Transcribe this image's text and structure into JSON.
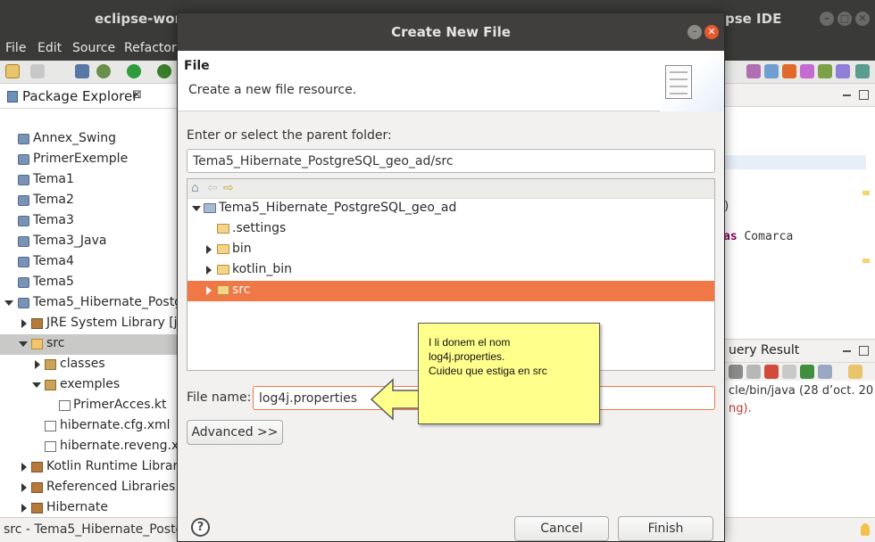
{
  "window": {
    "title_left": "eclipse-work",
    "title_right": "pse IDE",
    "controls": [
      "–",
      "□",
      "✕"
    ]
  },
  "menubar": [
    "File",
    "Edit",
    "Source",
    "Refactor"
  ],
  "explorer": {
    "tab_label": "Package Explorer",
    "tab_close": "⊠",
    "items": [
      {
        "label": "Annex_Swing",
        "icon": "project-icon"
      },
      {
        "label": "PrimerExemple",
        "icon": "project-icon"
      },
      {
        "label": "Tema1",
        "icon": "project-icon"
      },
      {
        "label": "Tema2",
        "icon": "project-icon"
      },
      {
        "label": "Tema3",
        "icon": "project-icon"
      },
      {
        "label": "Tema3_Java",
        "icon": "project-icon"
      },
      {
        "label": "Tema4",
        "icon": "project-icon"
      },
      {
        "label": "Tema5",
        "icon": "project-icon"
      },
      {
        "label": "Tema5_Hibernate_Postg",
        "icon": "project-icon"
      },
      {
        "label": "JRE System Library [ja",
        "icon": "library-icon"
      },
      {
        "label": "src",
        "icon": "source-folder-icon"
      },
      {
        "label": "classes",
        "icon": "package-icon"
      },
      {
        "label": "exemples",
        "icon": "package-icon"
      },
      {
        "label": "PrimerAcces.kt",
        "icon": "kotlin-file-icon"
      },
      {
        "label": "hibernate.cfg.xml",
        "icon": "xml-file-icon"
      },
      {
        "label": "hibernate.reveng.xm",
        "icon": "xml-file-icon"
      },
      {
        "label": "Kotlin Runtime Library",
        "icon": "library-icon"
      },
      {
        "label": "Referenced Libraries",
        "icon": "library-icon"
      },
      {
        "label": "Hibernate",
        "icon": "library-icon"
      }
    ]
  },
  "statusbar": {
    "text": "src - Tema5_Hibernate_Postg"
  },
  "right_pane": {
    "code_line1": ")",
    "code_line2_kw": "as",
    "code_line2_rest": " Comarca",
    "console_tab": "uery Result",
    "console_line1": "cle/bin/java  (28 d’oct. 20",
    "console_line2": "ng)."
  },
  "dialog": {
    "title": "Create New File",
    "header_title": "File",
    "header_desc": "Create a new file resource.",
    "parent_label": "Enter or select the parent folder:",
    "parent_value": "Tema5_Hibernate_PostgreSQL_geo_ad/src",
    "tree": [
      {
        "label": "Tema5_Hibernate_PostgreSQL_geo_ad",
        "expanded": true
      },
      {
        "label": ".settings"
      },
      {
        "label": "bin"
      },
      {
        "label": "kotlin_bin"
      },
      {
        "label": "src",
        "selected": true
      }
    ],
    "filename_label": "File name:",
    "filename_value": "log4j.properties",
    "advanced_button": "Advanced >>",
    "help_button": "?",
    "cancel_button": "Cancel",
    "finish_button": "Finish"
  },
  "callout": {
    "lines": [
      "I li donem el nom",
      "log4j.properties.",
      "Cuideu que estiga en src"
    ]
  },
  "colors": {
    "selection": "#f07746",
    "callout_bg": "#ffff8c",
    "titlebar": "#3a3a38"
  }
}
